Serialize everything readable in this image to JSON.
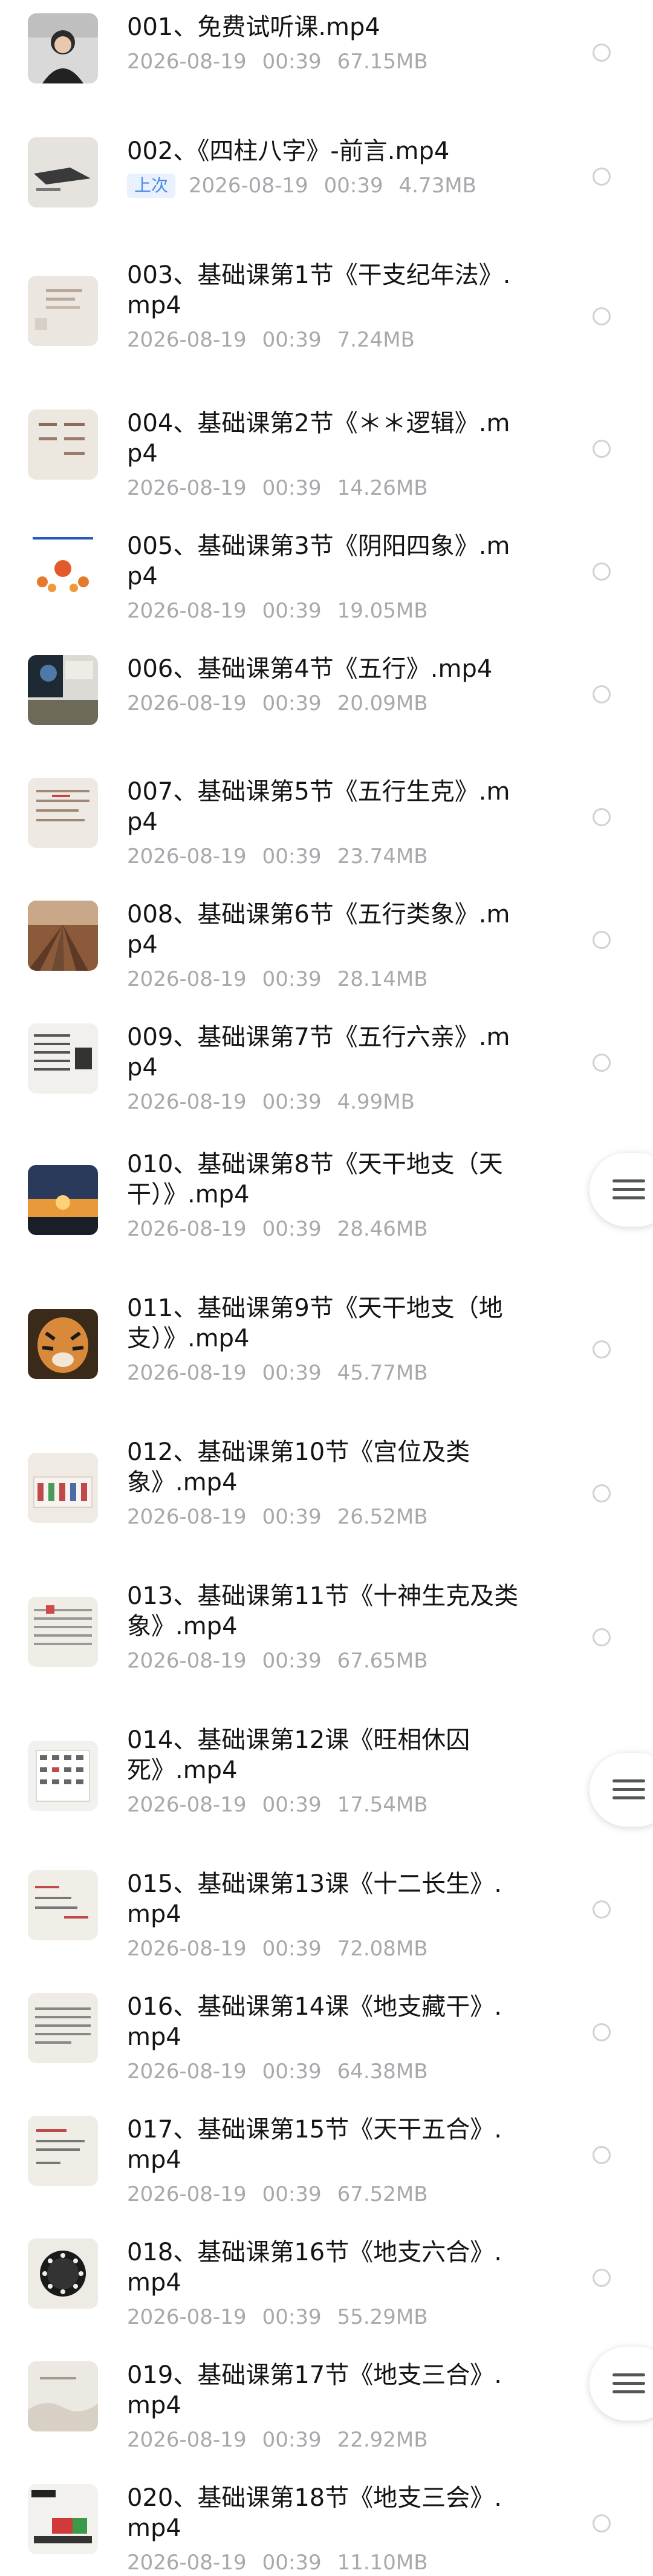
{
  "files": [
    {
      "name": "001、免费试听课.mp4",
      "date": "2026-08-19",
      "time": "00:39",
      "size": "67.15MB"
    },
    {
      "name": "002、《四柱八字》-前言.mp4",
      "badge": "上次",
      "date": "2026-08-19",
      "time": "00:39",
      "size": "4.73MB"
    },
    {
      "name": "003、基础课第1节《干支纪年法》.mp4",
      "date": "2026-08-19",
      "time": "00:39",
      "size": "7.24MB"
    },
    {
      "name": "004、基础课第2节《＊＊逻辑》.mp4",
      "date": "2026-08-19",
      "time": "00:39",
      "size": "14.26MB"
    },
    {
      "name": "005、基础课第3节《阴阳四象》.mp4",
      "date": "2026-08-19",
      "time": "00:39",
      "size": "19.05MB"
    },
    {
      "name": "006、基础课第4节《五行》.mp4",
      "date": "2026-08-19",
      "time": "00:39",
      "size": "20.09MB"
    },
    {
      "name": "007、基础课第5节《五行生克》.mp4",
      "date": "2026-08-19",
      "time": "00:39",
      "size": "23.74MB"
    },
    {
      "name": "008、基础课第6节《五行类象》.mp4",
      "date": "2026-08-19",
      "time": "00:39",
      "size": "28.14MB"
    },
    {
      "name": "009、基础课第7节《五行六亲》.mp4",
      "date": "2026-08-19",
      "time": "00:39",
      "size": "4.99MB"
    },
    {
      "name": "010、基础课第8节《天干地支（天干）》.mp4",
      "date": "2026-08-19",
      "time": "00:39",
      "size": "28.46MB"
    },
    {
      "name": "011、基础课第9节《天干地支（地支）》.mp4",
      "date": "2026-08-19",
      "time": "00:39",
      "size": "45.77MB"
    },
    {
      "name": "012、基础课第10节《宫位及类象》.mp4",
      "date": "2026-08-19",
      "time": "00:39",
      "size": "26.52MB"
    },
    {
      "name": "013、基础课第11节《十神生克及类象》.mp4",
      "date": "2026-08-19",
      "time": "00:39",
      "size": "67.65MB"
    },
    {
      "name": "014、基础课第12课《旺相休囚死》.mp4",
      "date": "2026-08-19",
      "time": "00:39",
      "size": "17.54MB"
    },
    {
      "name": "015、基础课第13课《十二长生》.mp4",
      "date": "2026-08-19",
      "time": "00:39",
      "size": "72.08MB"
    },
    {
      "name": "016、基础课第14课《地支藏干》.mp4",
      "date": "2026-08-19",
      "time": "00:39",
      "size": "64.38MB"
    },
    {
      "name": "017、基础课第15节《天干五合》.mp4",
      "date": "2026-08-19",
      "time": "00:39",
      "size": "67.52MB"
    },
    {
      "name": "018、基础课第16节《地支六合》.mp4",
      "date": "2026-08-19",
      "time": "00:39",
      "size": "55.29MB"
    },
    {
      "name": "019、基础课第17节《地支三合》.mp4",
      "date": "2026-08-19",
      "time": "00:39",
      "size": "22.92MB"
    },
    {
      "name": "020、基础课第18节《地支三会》.mp4",
      "date": "2026-08-19",
      "time": "00:39",
      "size": "11.10MB"
    }
  ],
  "floating_menu": {
    "icon": "menu-icon"
  },
  "colors": {
    "title": "#141414",
    "meta": "#a8a8ad",
    "badge_bg": "#e8f1fd",
    "badge_text": "#4a89e8",
    "radio_border": "#d2d2d6"
  }
}
